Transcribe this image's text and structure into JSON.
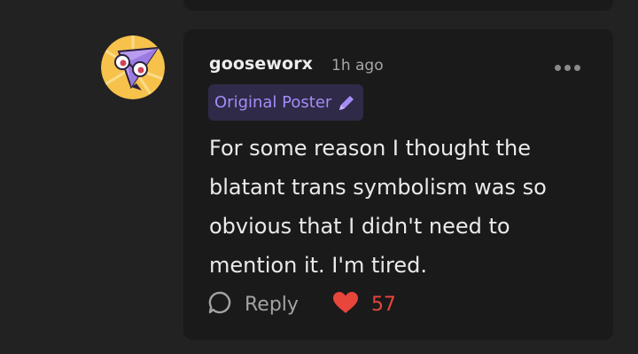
{
  "comment": {
    "author": "gooseworx",
    "timestamp": "1h ago",
    "badge_label": "Original Poster",
    "body": "For some reason I thought the blatant trans symbolism was so obvious that I didn't need to mention it. I'm tired.",
    "reply_label": "Reply",
    "like_count": "57"
  },
  "icons": {
    "more": "more-dots-icon",
    "badge": "pencil-icon",
    "reply": "speech-bubble-icon",
    "like": "heart-icon"
  },
  "colors": {
    "page_background": "#222223",
    "card_background": "#1a1a1b",
    "badge_background": "#2f2a47",
    "badge_text": "#a58cf7",
    "like_accent": "#e8453b"
  }
}
